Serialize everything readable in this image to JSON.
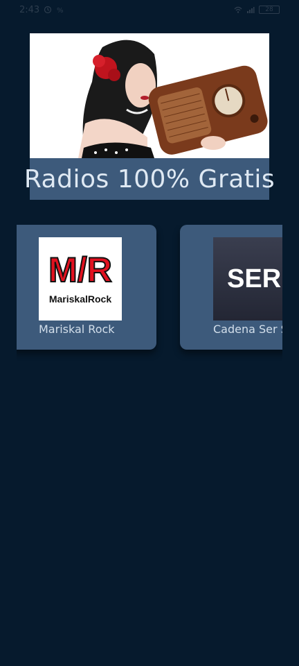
{
  "status_bar": {
    "time": "2:43",
    "battery": "28"
  },
  "hero": {
    "title": "Radios 100% Gratis"
  },
  "stations": [
    {
      "name": "Mariskal Rock",
      "logo_text_main": "M/R",
      "logo_text_sub": "MariskalRock"
    },
    {
      "name": "Cadena Ser S",
      "logo_text_main": "SER"
    }
  ],
  "colors": {
    "background": "#061a2d",
    "card": "#3d5a7b",
    "accent_red": "#e1111f"
  }
}
